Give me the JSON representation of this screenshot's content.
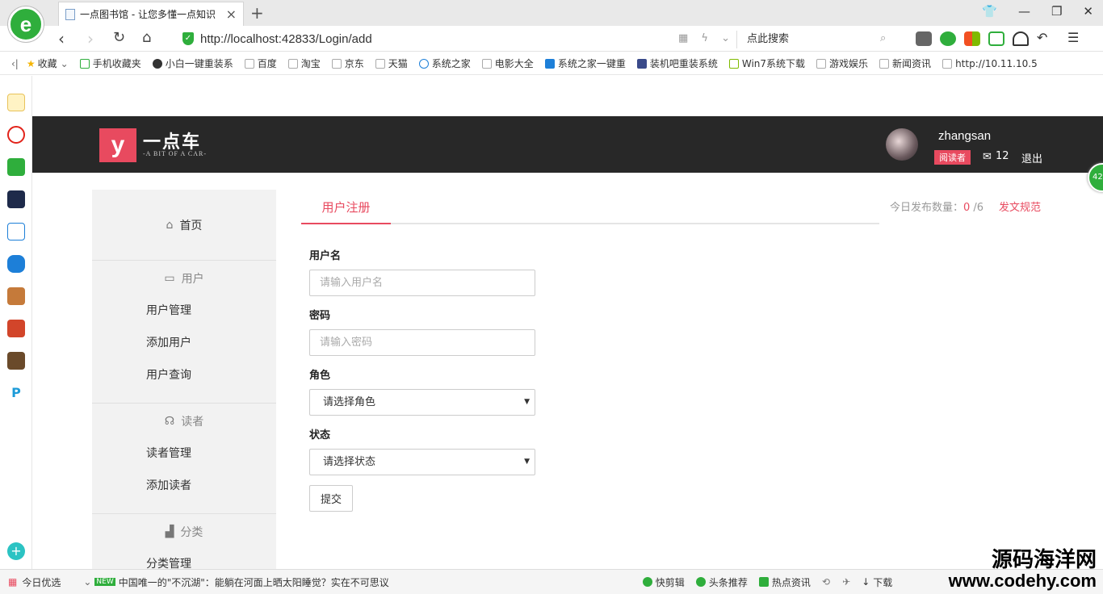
{
  "browser": {
    "tab_title": "一点图书馆 - 让您多懂一点知识",
    "url": "http://localhost:42833/Login/add",
    "search_placeholder": "点此搜索",
    "favorites": [
      "收藏",
      "手机收藏夹",
      "小白一键重装系",
      "百度",
      "淘宝",
      "京东",
      "天猫",
      "系统之家",
      "电影大全",
      "系统之家一键重",
      "装机吧重装系统",
      "Win7系统下载",
      "游戏娱乐",
      "新闻资讯",
      "http://10.11.10.5"
    ]
  },
  "statusbar": {
    "today": "今日优选",
    "news": "中国唯一的\"不沉湖\"：能躺在河面上晒太阳睡觉？实在不可思议",
    "items": [
      "快剪辑",
      "头条推荐",
      "热点资讯",
      "下载"
    ],
    "new_badge": "NEW",
    "float_count": "42"
  },
  "watermark": {
    "cn": "源码海洋网",
    "en": "www.codehy.com"
  },
  "header": {
    "logo_text": "一点车",
    "logo_sub": "-A BIT OF A CAR-",
    "username": "zhangsan",
    "role": "阅读者",
    "message_count": "12",
    "logout": "退出"
  },
  "sidebar": {
    "home": "首页",
    "groups": [
      {
        "title": "用户",
        "items": [
          "用户管理",
          "添加用户",
          "用户查询"
        ]
      },
      {
        "title": "读者",
        "items": [
          "读者管理",
          "添加读者"
        ]
      },
      {
        "title": "分类",
        "items": [
          "分类管理"
        ]
      }
    ]
  },
  "main": {
    "tab": "用户注册",
    "publish_label": "今日发布数量：",
    "publish_count": "0",
    "publish_total": " /6",
    "rules_link": "发文规范"
  },
  "form": {
    "username_label": "用户名",
    "username_placeholder": "请输入用户名",
    "password_label": "密码",
    "password_placeholder": "请输入密码",
    "role_label": "角色",
    "role_value": "请选择角色",
    "status_label": "状态",
    "status_value": "请选择状态",
    "submit": "提交"
  },
  "colors": {
    "accent": "#e84a5f",
    "header_bg": "#282828",
    "sidebar_bg": "#f2f2f2",
    "browser_green": "#2fae3c"
  }
}
